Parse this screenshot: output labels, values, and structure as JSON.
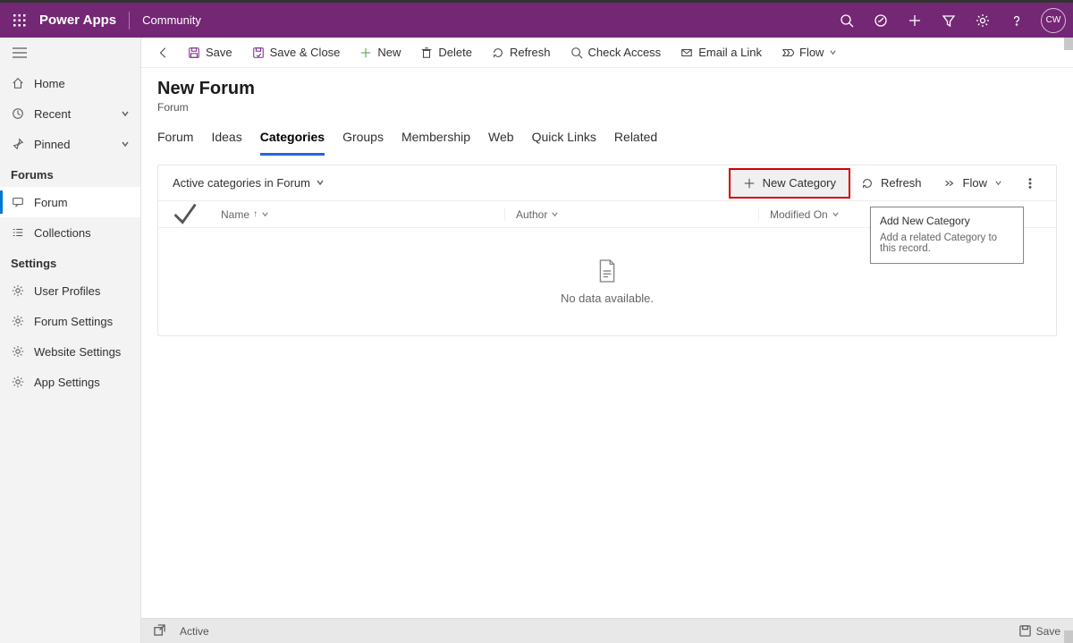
{
  "topbar": {
    "app_title": "Power Apps",
    "app_sub": "Community",
    "avatar_text": "CW"
  },
  "nav": {
    "home": "Home",
    "recent": "Recent",
    "pinned": "Pinned",
    "section_forums": "Forums",
    "forum": "Forum",
    "collections": "Collections",
    "section_settings": "Settings",
    "user_profiles": "User Profiles",
    "forum_settings": "Forum Settings",
    "website_settings": "Website Settings",
    "app_settings": "App Settings"
  },
  "cmdbar": {
    "save": "Save",
    "save_close": "Save & Close",
    "new": "New",
    "delete": "Delete",
    "refresh": "Refresh",
    "check_access": "Check Access",
    "email_link": "Email a Link",
    "flow": "Flow"
  },
  "record": {
    "title": "New Forum",
    "subtitle": "Forum"
  },
  "tabs": {
    "forum": "Forum",
    "ideas": "Ideas",
    "categories": "Categories",
    "groups": "Groups",
    "membership": "Membership",
    "web": "Web",
    "quick_links": "Quick Links",
    "related": "Related"
  },
  "subgrid": {
    "view_label": "Active categories in Forum",
    "new_category": "New Category",
    "refresh": "Refresh",
    "flow": "Flow",
    "col_name": "Name",
    "col_author": "Author",
    "col_modified": "Modified On",
    "empty_message": "No data available."
  },
  "tooltip": {
    "title": "Add New Category",
    "body": "Add a related Category to this record."
  },
  "statusbar": {
    "state": "Active",
    "save": "Save"
  }
}
